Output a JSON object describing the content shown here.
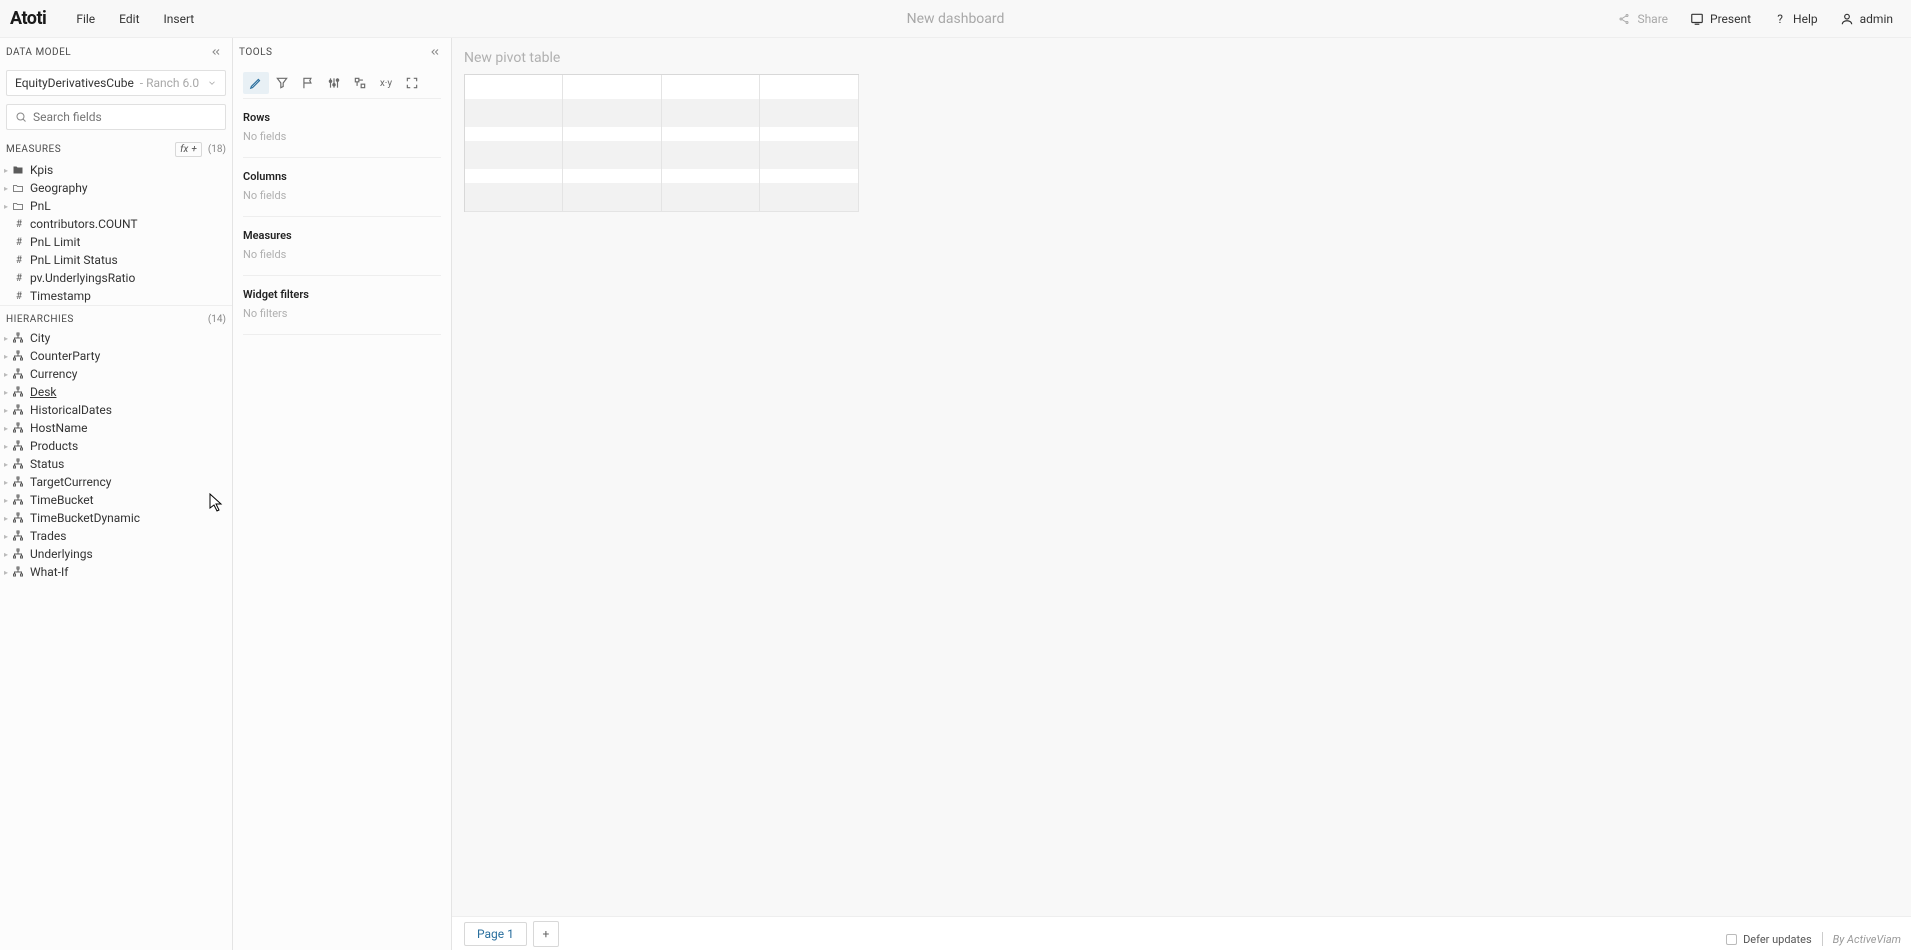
{
  "app": {
    "logo": "Atoti"
  },
  "menu": {
    "file": "File",
    "edit": "Edit",
    "insert": "Insert"
  },
  "dashboard_title": "New dashboard",
  "topbar": {
    "share": "Share",
    "present": "Present",
    "help": "Help",
    "user": "admin"
  },
  "data_model": {
    "title": "DATA MODEL",
    "cube": {
      "name": "EquityDerivativesCube",
      "sub": " - Ranch 6.0"
    },
    "search_placeholder": "Search fields",
    "measures": {
      "title": "MEASURES",
      "fx": "fx",
      "count": "(18)",
      "items": [
        {
          "icon": "folder",
          "label": "Kpis",
          "expandable": true
        },
        {
          "icon": "folder-open",
          "label": "Geography",
          "expandable": true
        },
        {
          "icon": "folder-open",
          "label": "PnL",
          "expandable": true
        },
        {
          "icon": "hash",
          "label": "contributors.COUNT",
          "expandable": false
        },
        {
          "icon": "hash",
          "label": "PnL Limit",
          "expandable": false
        },
        {
          "icon": "hash",
          "label": "PnL Limit Status",
          "expandable": false
        },
        {
          "icon": "hash",
          "label": "pv.UnderlyingsRatio",
          "expandable": false
        },
        {
          "icon": "hash",
          "label": "Timestamp",
          "expandable": false
        }
      ]
    },
    "hierarchies": {
      "title": "HIERARCHIES",
      "count": "(14)",
      "items": [
        {
          "label": "City"
        },
        {
          "label": "CounterParty"
        },
        {
          "label": "Currency"
        },
        {
          "label": "Desk",
          "underline": true
        },
        {
          "label": "HistoricalDates"
        },
        {
          "label": "HostName"
        },
        {
          "label": "Products"
        },
        {
          "label": "Status"
        },
        {
          "label": "TargetCurrency"
        },
        {
          "label": "TimeBucket"
        },
        {
          "label": "TimeBucketDynamic"
        },
        {
          "label": "Trades"
        },
        {
          "label": "Underlyings"
        },
        {
          "label": "What-If"
        }
      ]
    }
  },
  "tools": {
    "title": "TOOLS",
    "icons": [
      {
        "name": "pencil-icon",
        "active": true
      },
      {
        "name": "filter-icon"
      },
      {
        "name": "flag-icon"
      },
      {
        "name": "sliders-icon"
      },
      {
        "name": "axis-swap-icon"
      },
      {
        "name": "xy-icon",
        "label": "x·y"
      },
      {
        "name": "expand-icon"
      }
    ],
    "sections": [
      {
        "title": "Rows",
        "empty": "No fields"
      },
      {
        "title": "Columns",
        "empty": "No fields"
      },
      {
        "title": "Measures",
        "empty": "No fields"
      },
      {
        "title": "Widget filters",
        "empty": "No filters"
      }
    ]
  },
  "canvas": {
    "widget_title": "New pivot table"
  },
  "pages": {
    "page1": "Page 1"
  },
  "status": {
    "defer": "Defer updates",
    "byline": "By ActiveViam"
  }
}
